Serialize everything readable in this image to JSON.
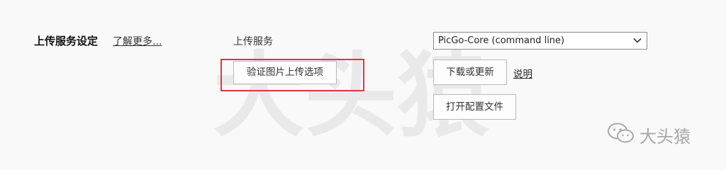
{
  "section": {
    "title": "上传服务设定",
    "learn_more": "了解更多..."
  },
  "upload_service": {
    "label": "上传服务",
    "selected": "PicGo-Core (command line)"
  },
  "buttons": {
    "verify": "验证图片上传选项",
    "download_update": "下载或更新",
    "help": "说明",
    "open_config": "打开配置文件"
  },
  "watermark": {
    "big_text": "大头猿",
    "logo_text": "大头猿"
  },
  "colors": {
    "highlight": "#e0353c"
  },
  "icons": {
    "dropdown": "chevron-down-icon",
    "watermark_logo": "wechat-icon"
  }
}
